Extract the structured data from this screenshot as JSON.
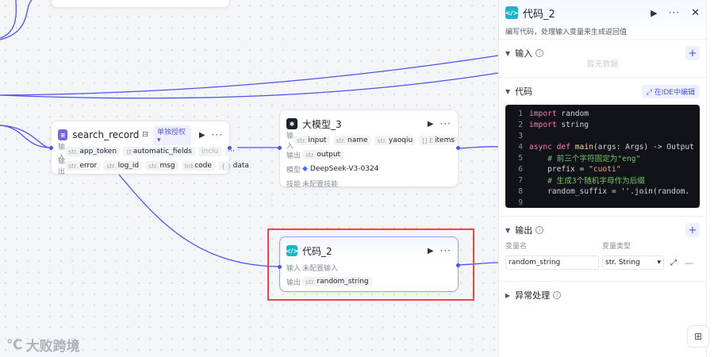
{
  "nodes": {
    "search_record": {
      "title": "search_record",
      "badge": "单独授权",
      "input_label": "输入",
      "output_label": "输出",
      "inputs": [
        {
          "type": "str.",
          "name": "app_token"
        },
        {
          "type": "",
          "name": "automatic_fields"
        },
        {
          "type": "",
          "name": "inclu"
        }
      ],
      "outputs": [
        {
          "type": "str.",
          "name": "error"
        },
        {
          "type": "str.",
          "name": "log_id"
        },
        {
          "type": "str.",
          "name": "msg"
        },
        {
          "type": "Int",
          "name": "code"
        },
        {
          "type": "{ }",
          "name": "data"
        }
      ]
    },
    "llm": {
      "title": "大模型_3",
      "input_label": "输入",
      "output_label": "输出",
      "model_label": "模型",
      "skill_label": "技能",
      "inputs": [
        {
          "type": "str.",
          "name": "input"
        },
        {
          "type": "str.",
          "name": "name"
        },
        {
          "type": "str.",
          "name": "yaoqiu"
        },
        {
          "type": "[] E",
          "name": "items"
        }
      ],
      "outputs": [
        {
          "type": "str.",
          "name": "output"
        }
      ],
      "model": "DeepSeek-V3-0324",
      "skill": "未配置技能"
    },
    "code": {
      "title": "代码_2",
      "input_label": "输入",
      "output_label": "输出",
      "input_value": "未配置输入",
      "outputs": [
        {
          "type": "str.",
          "name": "random_string"
        }
      ]
    }
  },
  "watermark": "大败跨境",
  "panel": {
    "title": "代码_2",
    "desc": "编写代码，处理输入变量来生成返回值",
    "input_section": {
      "title": "输入",
      "empty": "暂无数据"
    },
    "code_section": {
      "title": "代码",
      "ide_button": "在IDE中编辑",
      "lines": [
        {
          "n": "1",
          "text": "import random"
        },
        {
          "n": "2",
          "text": "import string"
        },
        {
          "n": "3",
          "text": ""
        },
        {
          "n": "4",
          "text": "async def main(args: Args) -> Output"
        },
        {
          "n": "5",
          "text": "    # 前三个字符固定为\"eng\""
        },
        {
          "n": "6",
          "text": "    prefix = \"cuoti\""
        },
        {
          "n": "7",
          "text": "    # 生成3个随机字母作为后缀"
        },
        {
          "n": "8",
          "text": "    random_suffix = ''.join(random."
        },
        {
          "n": "9",
          "text": ""
        }
      ]
    },
    "output_section": {
      "title": "输出",
      "col_name": "变量名",
      "col_type": "变量类型",
      "var_name": "random_string",
      "var_type": "str. String"
    },
    "error_section": {
      "title": "异常处理"
    }
  },
  "colors": {
    "accent": "#4d53e8",
    "selection": "#e14b4b",
    "code_bg": "#111318"
  }
}
